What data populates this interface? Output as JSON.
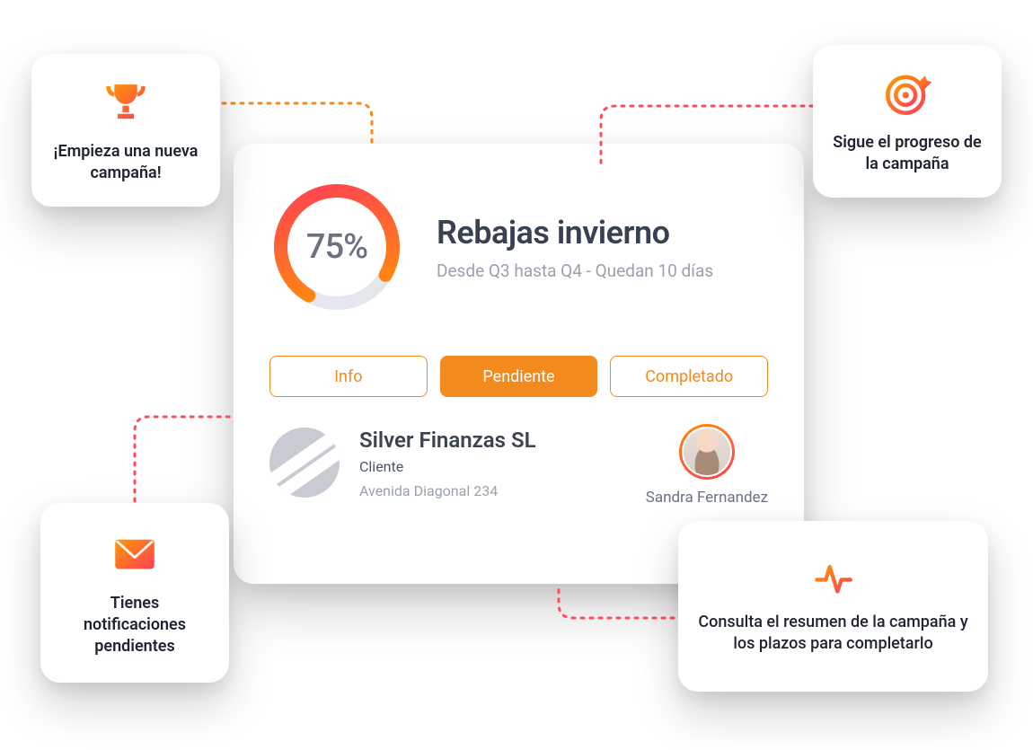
{
  "campaign": {
    "title": "Rebajas invierno",
    "subtitle": "Desde Q3 hasta Q4 - Quedan 10 días",
    "progress_label": "75%",
    "progress_percent": 75
  },
  "tabs": {
    "info": "Info",
    "pending": "Pendiente",
    "completed": "Completado"
  },
  "client": {
    "name": "Silver Finanzas SL",
    "type": "Cliente",
    "address": "Avenida Diagonal 234"
  },
  "contact": {
    "name": "Sandra Fernandez"
  },
  "callouts": {
    "top_left": "¡Empieza una nueva campaña!",
    "top_right": "Sigue el progreso de la campaña",
    "bottom_left": "Tienes notificaciones pendientes",
    "bottom_right": "Consulta el resumen de la campaña y los plazos para completarlo"
  },
  "colors": {
    "accent": "#f28a1e",
    "grad_start": "#ff8a00",
    "grad_end": "#ff3d57"
  }
}
